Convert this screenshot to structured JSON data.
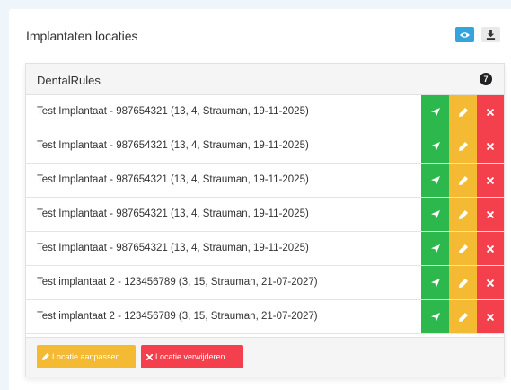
{
  "header": {
    "title": "Implantaten locaties"
  },
  "toolbar": {
    "view_icon": "eye-icon",
    "download_icon": "download-icon"
  },
  "panel": {
    "title": "DentalRules",
    "count": "7"
  },
  "rows": [
    {
      "label": "Test Implantaat - 987654321 (13, 4, Strauman, 19-11-2025)"
    },
    {
      "label": "Test Implantaat - 987654321 (13, 4, Strauman, 19-11-2025)"
    },
    {
      "label": "Test Implantaat - 987654321 (13, 4, Strauman, 19-11-2025)"
    },
    {
      "label": "Test Implantaat - 987654321 (13, 4, Strauman, 19-11-2025)"
    },
    {
      "label": "Test Implantaat - 987654321 (13, 4, Strauman, 19-11-2025)"
    },
    {
      "label": "Test implantaat 2 - 123456789 (3, 15, Strauman, 21-07-2027)"
    },
    {
      "label": "Test implantaat 2 - 123456789 (3, 15, Strauman, 21-07-2027)"
    }
  ],
  "actions": {
    "edit_location": "Locatie aanpassen",
    "delete_location": "Locatie verwijderen"
  },
  "colors": {
    "location": "#2db84d",
    "edit": "#f5ba33",
    "delete": "#f3404c",
    "view": "#35a4dd"
  }
}
